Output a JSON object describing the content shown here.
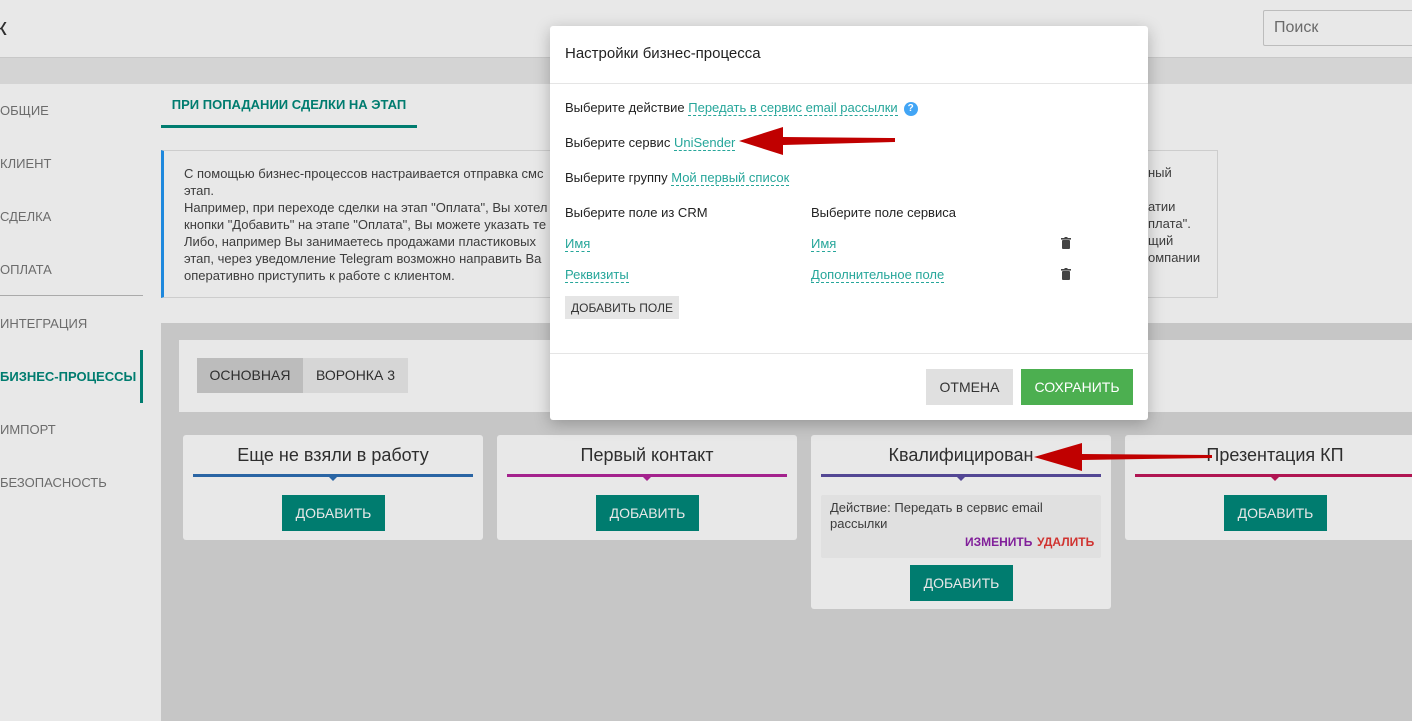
{
  "topbar": {
    "left_char": "к",
    "search_placeholder": "Поиск"
  },
  "sidebar": {
    "items": [
      {
        "label": "ОБЩИЕ"
      },
      {
        "label": "КЛИЕНТ"
      },
      {
        "label": "СДЕЛКА"
      },
      {
        "label": "ОПЛАТА"
      },
      {
        "label": "ИНТЕГРАЦИЯ"
      },
      {
        "label": "БИЗНЕС-ПРОЦЕССЫ",
        "active": true
      },
      {
        "label": "ИМПОРТ"
      },
      {
        "label": "БЕЗОПАСНОСТЬ"
      }
    ]
  },
  "main": {
    "tab_label": "ПРИ ПОПАДАНИИ СДЕЛКИ НА ЭТАП",
    "info_lines": [
      "С помощью бизнес-процессов настраивается отправка смс",
      "этап.",
      "Например, при переходе сделки на этап \"Оплата\", Вы хотел",
      "кнопки \"Добавить\" на этапе \"Оплата\", Вы можете указать те",
      "Либо, например Вы занимаетесь продажами пластиковых",
      "этап, через уведомление Telegram возможно направить Ва",
      "оперативно приступить к работе с клиентом."
    ],
    "info_right_lines": [
      "ный",
      "",
      "атии",
      "плата\".",
      "щий",
      "омпании"
    ],
    "funnel_tabs": [
      {
        "label": "ОСНОВНАЯ",
        "active": true
      },
      {
        "label": "ВОРОНКА 3"
      }
    ],
    "stages": [
      {
        "title": "Еще не взяли в работу",
        "color": "#2f6fb5",
        "add_label": "ДОБАВИТЬ"
      },
      {
        "title": "Первый контакт",
        "color": "#b5269b",
        "add_label": "ДОБАВИТЬ"
      },
      {
        "title": "Квалифицирован",
        "color": "#5c4fa3",
        "add_label": "ДОБАВИТЬ",
        "action": {
          "text": "Действие: Передать в сервис email рассылки",
          "edit_label": "ИЗМЕНИТЬ",
          "delete_label": "УДАЛИТЬ"
        }
      },
      {
        "title": "Презентация КП",
        "color": "#c2185b",
        "add_label": "ДОБАВИТЬ"
      }
    ]
  },
  "modal": {
    "title": "Настройки бизнес-процесса",
    "action_label": "Выберите действие",
    "action_value": "Передать в сервис email рассылки",
    "help_icon": "?",
    "service_label": "Выберите сервис",
    "service_value": "UniSender",
    "group_label": "Выберите группу",
    "group_value": "Мой первый список",
    "crm_field_header": "Выберите поле из CRM",
    "service_field_header": "Выберите поле сервиса",
    "field_rows": [
      {
        "crm": "Имя",
        "service": "Имя"
      },
      {
        "crm": "Реквизиты",
        "service": "Дополнительное поле"
      }
    ],
    "add_field_label": "ДОБАВИТЬ ПОЛЕ",
    "cancel_label": "ОТМЕНА",
    "save_label": "СОХРАНИТЬ"
  },
  "colors": {
    "accent": "#00897b",
    "link": "#26a69a",
    "save": "#4caf50",
    "arrow": "#c00000"
  }
}
